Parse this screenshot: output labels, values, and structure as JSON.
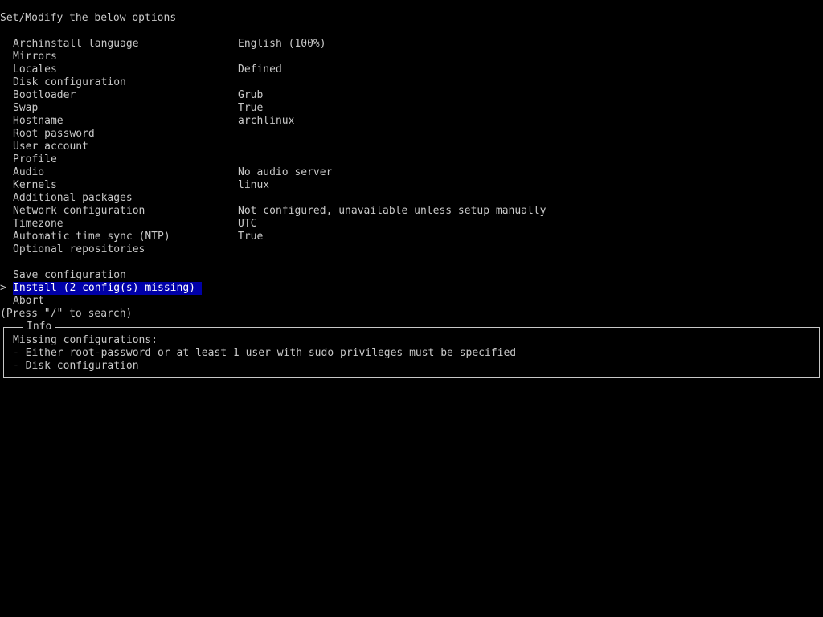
{
  "title": "Set/Modify the below options",
  "options": [
    {
      "label": "Archinstall language",
      "value": "English (100%)"
    },
    {
      "label": "Mirrors",
      "value": ""
    },
    {
      "label": "Locales",
      "value": "Defined"
    },
    {
      "label": "Disk configuration",
      "value": ""
    },
    {
      "label": "Bootloader",
      "value": "Grub"
    },
    {
      "label": "Swap",
      "value": "True"
    },
    {
      "label": "Hostname",
      "value": "archlinux"
    },
    {
      "label": "Root password",
      "value": ""
    },
    {
      "label": "User account",
      "value": ""
    },
    {
      "label": "Profile",
      "value": ""
    },
    {
      "label": "Audio",
      "value": "No audio server"
    },
    {
      "label": "Kernels",
      "value": "linux"
    },
    {
      "label": "Additional packages",
      "value": ""
    },
    {
      "label": "Network configuration",
      "value": "Not configured, unavailable unless setup manually"
    },
    {
      "label": "Timezone",
      "value": "UTC"
    },
    {
      "label": "Automatic time sync (NTP)",
      "value": "True"
    },
    {
      "label": "Optional repositories",
      "value": ""
    }
  ],
  "actions": {
    "save": "Save configuration",
    "install": "Install (2 config(s) missing)",
    "abort": "Abort"
  },
  "cursor": ">",
  "search_hint": "(Press \"/\" to search)",
  "info": {
    "title": "Info",
    "heading": "Missing configurations:",
    "items": [
      "- Either root-password or at least 1 user with sudo privileges must be specified",
      "- Disk configuration"
    ]
  },
  "colors": {
    "background": "#000000",
    "text": "#c8c8c8",
    "highlight_bg": "#0000a8",
    "highlight_text": "#ffffff"
  }
}
